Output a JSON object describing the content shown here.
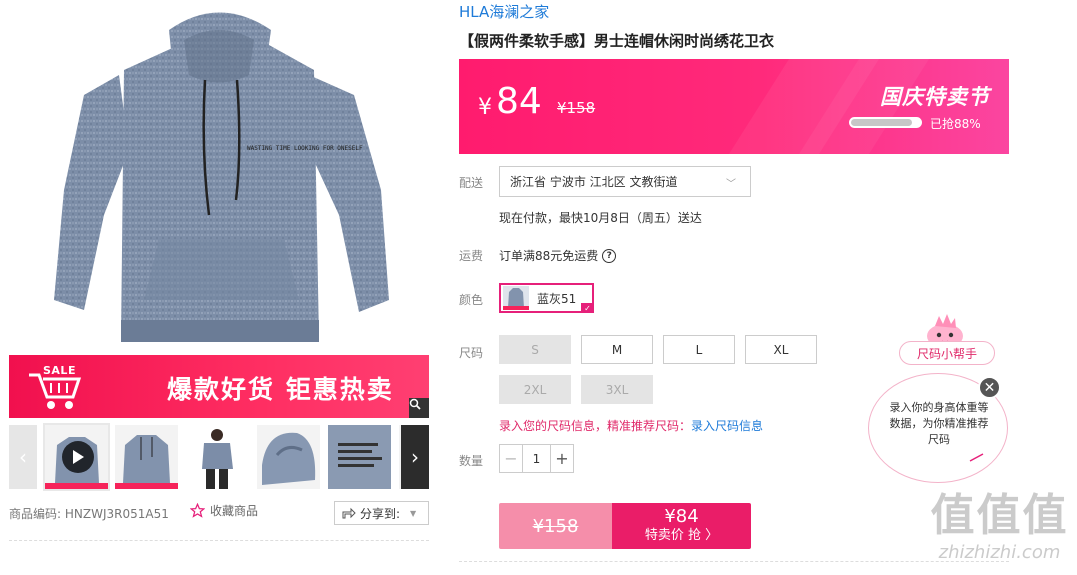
{
  "gallery": {
    "sale_badge": "SALE",
    "banner_slogan": "爆款好货 钜惠热卖",
    "print_text": "WASTING TIME LOOKING FOR ONESELF",
    "sku_label": "商品编码:",
    "sku_value": "HNZWJ3R051A51",
    "favorite_label": "收藏商品",
    "share_label": "分享到:"
  },
  "product": {
    "brand": "HLA海澜之家",
    "title": "【假两件柔软手感】男士连帽休闲时尚绣花卫衣"
  },
  "price": {
    "currency": "¥",
    "current": "84",
    "original": "¥158",
    "festival": "国庆特卖节",
    "sold_percent": 88,
    "sold_label": "已抢88%"
  },
  "delivery": {
    "label": "配送",
    "address": "浙江省 宁波市 江北区 文教街道",
    "note": "现在付款，最快10月8日（周五）送达"
  },
  "freight": {
    "label": "运费",
    "text": "订单满88元免运费",
    "help": "?"
  },
  "color": {
    "label": "颜色",
    "selected": "蓝灰51"
  },
  "size": {
    "label": "尺码",
    "options": [
      "S",
      "M",
      "L",
      "XL",
      "2XL",
      "3XL"
    ],
    "tip_prefix": "录入您的尺码信息，精准推荐尺码：",
    "tip_link": "录入尺码信息"
  },
  "quantity": {
    "label": "数量",
    "value": "1",
    "minus": "−",
    "plus": "+"
  },
  "buy": {
    "original": "¥158",
    "deal_price": "¥84",
    "deal_label": "特卖价 抢 〉"
  },
  "helper": {
    "button": "尺码小帮手",
    "bubble": "录入你的身高体重等数据，为你精准推荐尺码",
    "close": "✕"
  },
  "watermark": {
    "big": "值值值",
    "small": "zhizhizhi.com"
  },
  "colors": {
    "accent": "#ea1d68",
    "link": "#1f7bd8",
    "banner": "#f1104e"
  }
}
